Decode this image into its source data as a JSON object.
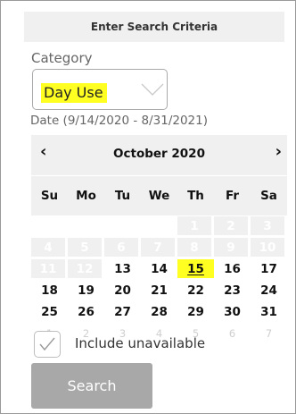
{
  "header": {
    "title": "Enter Search Criteria"
  },
  "category": {
    "label": "Category",
    "selected": "Day Use",
    "highlight_color": "#ffff22"
  },
  "date": {
    "label": "Date (9/14/2020 - 8/31/2021)"
  },
  "calendar": {
    "prev": "‹",
    "next": "›",
    "month": "October 2020",
    "weekdays": [
      "Su",
      "Mo",
      "Tu",
      "We",
      "Th",
      "Fr",
      "Sa"
    ],
    "days": [
      {
        "n": "",
        "s": "blank"
      },
      {
        "n": "",
        "s": "blank"
      },
      {
        "n": "",
        "s": "blank"
      },
      {
        "n": "",
        "s": "blank"
      },
      {
        "n": "1",
        "s": "unavail"
      },
      {
        "n": "2",
        "s": "unavail"
      },
      {
        "n": "3",
        "s": "unavail"
      },
      {
        "n": "4",
        "s": "unavail"
      },
      {
        "n": "5",
        "s": "unavail"
      },
      {
        "n": "6",
        "s": "unavail"
      },
      {
        "n": "7",
        "s": "unavail"
      },
      {
        "n": "8",
        "s": "unavail"
      },
      {
        "n": "9",
        "s": "unavail"
      },
      {
        "n": "10",
        "s": "unavail"
      },
      {
        "n": "11",
        "s": "unavail"
      },
      {
        "n": "12",
        "s": "unavail"
      },
      {
        "n": "13",
        "s": "avail"
      },
      {
        "n": "14",
        "s": "avail"
      },
      {
        "n": "15",
        "s": "highlight"
      },
      {
        "n": "16",
        "s": "avail"
      },
      {
        "n": "17",
        "s": "avail"
      },
      {
        "n": "18",
        "s": "avail"
      },
      {
        "n": "19",
        "s": "avail"
      },
      {
        "n": "20",
        "s": "avail"
      },
      {
        "n": "21",
        "s": "avail"
      },
      {
        "n": "22",
        "s": "avail"
      },
      {
        "n": "23",
        "s": "avail"
      },
      {
        "n": "24",
        "s": "avail"
      },
      {
        "n": "25",
        "s": "avail"
      },
      {
        "n": "26",
        "s": "avail"
      },
      {
        "n": "27",
        "s": "avail"
      },
      {
        "n": "28",
        "s": "avail"
      },
      {
        "n": "29",
        "s": "avail"
      },
      {
        "n": "30",
        "s": "avail"
      },
      {
        "n": "31",
        "s": "avail"
      },
      {
        "n": "1",
        "s": "other"
      },
      {
        "n": "2",
        "s": "other"
      },
      {
        "n": "3",
        "s": "other"
      },
      {
        "n": "4",
        "s": "other"
      },
      {
        "n": "5",
        "s": "other"
      },
      {
        "n": "6",
        "s": "other"
      },
      {
        "n": "7",
        "s": "other"
      }
    ]
  },
  "include_unavailable": {
    "label": "Include unavailable",
    "checked": true
  },
  "search_button": {
    "label": "Search"
  }
}
